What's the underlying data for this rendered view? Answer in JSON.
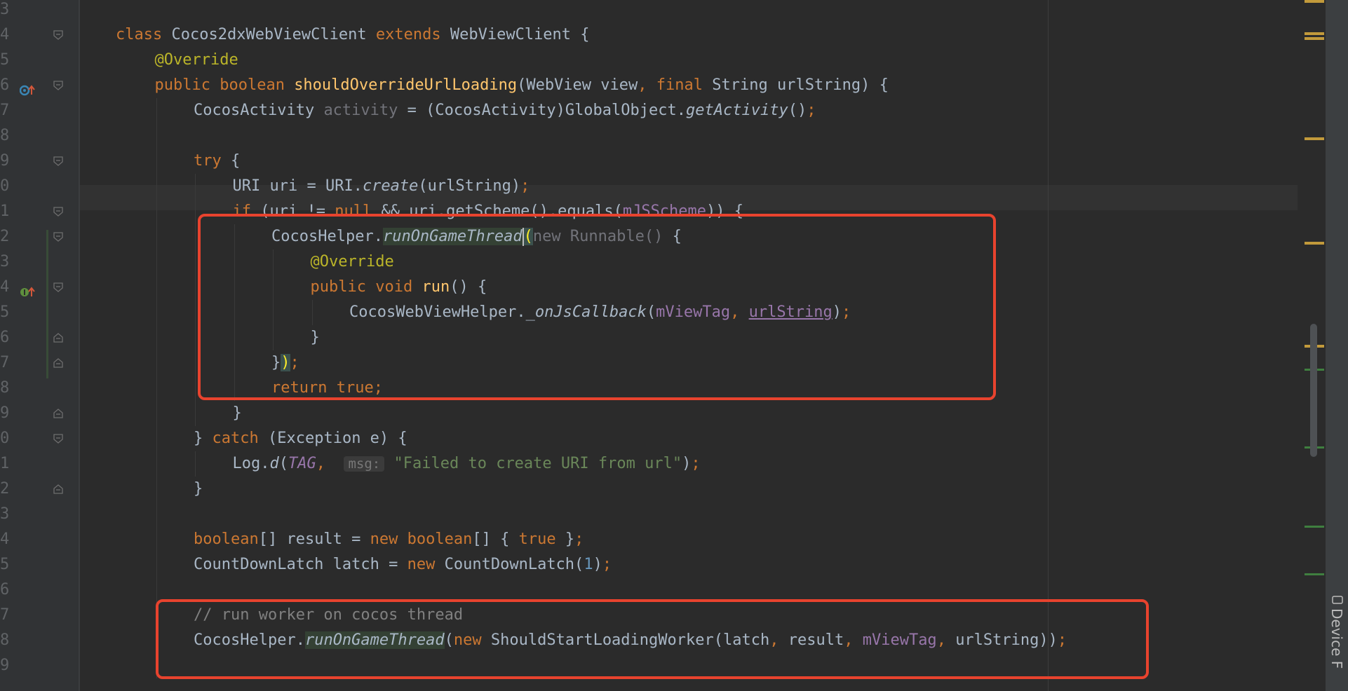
{
  "editor": {
    "lines": [
      {
        "num": "3",
        "tokens": []
      },
      {
        "num": "4",
        "tokens": [
          {
            "t": "class ",
            "c": "kw"
          },
          {
            "t": "Cocos2dxWebViewClient "
          },
          {
            "t": "extends ",
            "c": "kw"
          },
          {
            "t": "WebViewClient {"
          }
        ]
      },
      {
        "num": "5",
        "tokens": [
          {
            "t": "@Override",
            "c": "ann"
          }
        ]
      },
      {
        "num": "6",
        "tokens": [
          {
            "t": "public ",
            "c": "kw"
          },
          {
            "t": "boolean ",
            "c": "kw"
          },
          {
            "t": "shouldOverrideUrlLoading",
            "c": "fn"
          },
          {
            "t": "(WebView view"
          },
          {
            "t": ", ",
            "c": "kw"
          },
          {
            "t": "final ",
            "c": "kw"
          },
          {
            "t": "String urlString) {"
          }
        ]
      },
      {
        "num": "7",
        "tokens": [
          {
            "t": "CocosActivity "
          },
          {
            "t": "activity",
            "c": "unused"
          },
          {
            "t": " = (CocosActivity)GlobalObject."
          },
          {
            "t": "getActivity",
            "c": "italic"
          },
          {
            "t": "()"
          },
          {
            "t": ";",
            "c": "kw"
          }
        ]
      },
      {
        "num": "8",
        "tokens": []
      },
      {
        "num": "9",
        "tokens": [
          {
            "t": "try ",
            "c": "kw"
          },
          {
            "t": "{"
          }
        ]
      },
      {
        "num": "0",
        "tokens": [
          {
            "t": "URI uri = URI."
          },
          {
            "t": "create",
            "c": "italic"
          },
          {
            "t": "(urlString)"
          },
          {
            "t": ";",
            "c": "kw"
          }
        ]
      },
      {
        "num": "1",
        "tokens": [
          {
            "t": "if ",
            "c": "kw"
          },
          {
            "t": "(uri != "
          },
          {
            "t": "null ",
            "c": "kw"
          },
          {
            "t": "&& uri.getScheme().equals("
          },
          {
            "t": "mJSScheme",
            "c": "field"
          },
          {
            "t": ")) {"
          }
        ]
      },
      {
        "num": "2",
        "tokens": [
          {
            "t": "CocosHelper."
          },
          {
            "t": "runOnGameThread",
            "c": "italic bg-usage"
          },
          {
            "t": "",
            "c": "caret"
          },
          {
            "t": "(",
            "c": "brace-match"
          },
          {
            "t": "new Runnable() ",
            "c": "unused"
          },
          {
            "t": "{"
          }
        ]
      },
      {
        "num": "3",
        "tokens": [
          {
            "t": "@Override",
            "c": "ann"
          }
        ]
      },
      {
        "num": "4",
        "tokens": [
          {
            "t": "public ",
            "c": "kw"
          },
          {
            "t": "void ",
            "c": "kw"
          },
          {
            "t": "run",
            "c": "fn"
          },
          {
            "t": "() {"
          }
        ]
      },
      {
        "num": "5",
        "tokens": [
          {
            "t": "CocosWebViewHelper."
          },
          {
            "t": "_onJsCallback",
            "c": "italic"
          },
          {
            "t": "("
          },
          {
            "t": "mViewTag",
            "c": "field"
          },
          {
            "t": ", ",
            "c": "kw"
          },
          {
            "t": "urlString",
            "c": "field ul"
          },
          {
            "t": ")"
          },
          {
            "t": ";",
            "c": "kw"
          }
        ]
      },
      {
        "num": "6",
        "tokens": [
          {
            "t": "}"
          }
        ]
      },
      {
        "num": "7",
        "tokens": [
          {
            "t": "}"
          },
          {
            "t": ")",
            "c": "brace-match"
          },
          {
            "t": ";",
            "c": "kw"
          }
        ]
      },
      {
        "num": "8",
        "tokens": [
          {
            "t": "return ",
            "c": "kw"
          },
          {
            "t": "true",
            "c": "kw"
          },
          {
            "t": ";",
            "c": "kw"
          }
        ]
      },
      {
        "num": "9",
        "tokens": [
          {
            "t": "}"
          }
        ]
      },
      {
        "num": "0",
        "tokens": [
          {
            "t": "} "
          },
          {
            "t": "catch ",
            "c": "kw"
          },
          {
            "t": "(Exception e) {"
          }
        ]
      },
      {
        "num": "1",
        "tokens": [
          {
            "t": "Log."
          },
          {
            "t": "d",
            "c": "italic"
          },
          {
            "t": "("
          },
          {
            "t": "TAG",
            "c": "field italic"
          },
          {
            "t": ",  ",
            "c": "kw"
          },
          {
            "t": "msg:",
            "c": "hint"
          },
          {
            "t": " "
          },
          {
            "t": "\"Failed to create URI from url\"",
            "c": "str"
          },
          {
            "t": ")"
          },
          {
            "t": ";",
            "c": "kw"
          }
        ]
      },
      {
        "num": "2",
        "tokens": [
          {
            "t": "}"
          }
        ]
      },
      {
        "num": "3",
        "tokens": []
      },
      {
        "num": "4",
        "tokens": [
          {
            "t": "boolean",
            "c": "kw"
          },
          {
            "t": "[] result = "
          },
          {
            "t": "new ",
            "c": "kw"
          },
          {
            "t": "boolean",
            "c": "kw"
          },
          {
            "t": "[] { "
          },
          {
            "t": "true ",
            "c": "kw"
          },
          {
            "t": "}"
          },
          {
            "t": ";",
            "c": "kw"
          }
        ]
      },
      {
        "num": "5",
        "tokens": [
          {
            "t": "CountDownLatch latch = "
          },
          {
            "t": "new ",
            "c": "kw"
          },
          {
            "t": "CountDownLatch("
          },
          {
            "t": "1",
            "c": "num"
          },
          {
            "t": ")"
          },
          {
            "t": ";",
            "c": "kw"
          }
        ]
      },
      {
        "num": "6",
        "tokens": []
      },
      {
        "num": "7",
        "tokens": [
          {
            "t": "// run worker on cocos thread",
            "c": "cmt"
          }
        ]
      },
      {
        "num": "8",
        "tokens": [
          {
            "t": "CocosHelper."
          },
          {
            "t": "runOnGameThread",
            "c": "italic bg-usage"
          },
          {
            "t": "("
          },
          {
            "t": "new ",
            "c": "kw"
          },
          {
            "t": "ShouldStartLoadingWorker(latch"
          },
          {
            "t": ", ",
            "c": "kw"
          },
          {
            "t": "result"
          },
          {
            "t": ", ",
            "c": "kw"
          },
          {
            "t": "mViewTag",
            "c": "field"
          },
          {
            "t": ", ",
            "c": "kw"
          },
          {
            "t": "urlString))"
          },
          {
            "t": ";",
            "c": "kw"
          }
        ]
      },
      {
        "num": "9",
        "tokens": []
      }
    ]
  },
  "sidebar": {
    "tab_label": "Device F",
    "tab_icon": "device-icon"
  },
  "colors": {
    "background": "#2b2b2b",
    "keyword": "#cc7832",
    "annotation": "#bbb529",
    "method_decl": "#ffc66d",
    "field": "#9876aa",
    "string": "#6a8759",
    "number": "#6897bb",
    "comment": "#808080",
    "highlight_box": "#e8432e"
  }
}
